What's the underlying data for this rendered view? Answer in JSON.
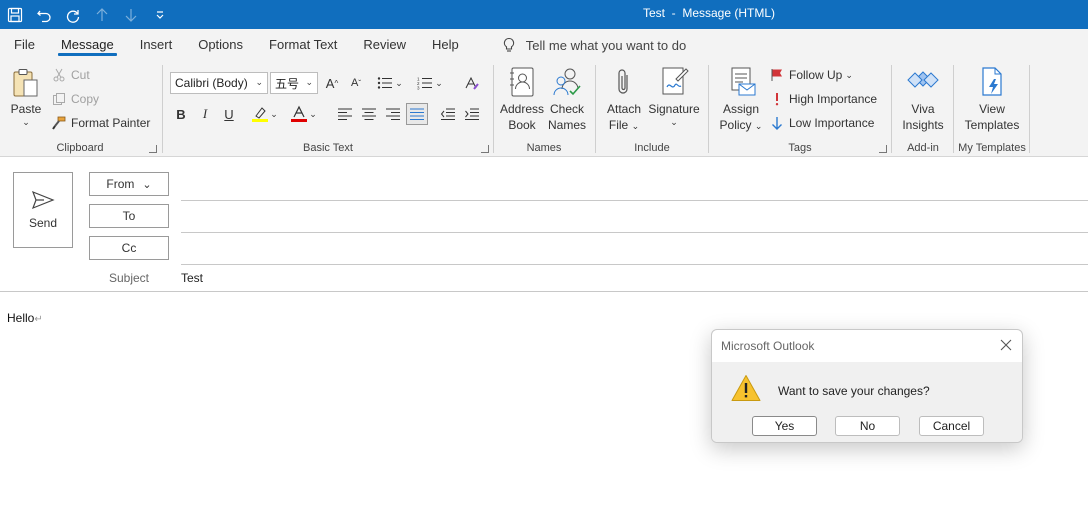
{
  "window": {
    "title": "Test  -  Message (HTML)"
  },
  "quick_access": [
    {
      "icon": "save-icon"
    },
    {
      "icon": "undo-icon"
    },
    {
      "icon": "redo-icon"
    },
    {
      "icon": "up-arrow-icon"
    },
    {
      "icon": "down-arrow-icon"
    },
    {
      "icon": "customize-icon"
    }
  ],
  "tabs": [
    {
      "label": "File"
    },
    {
      "label": "Message",
      "active": true
    },
    {
      "label": "Insert"
    },
    {
      "label": "Options"
    },
    {
      "label": "Format Text"
    },
    {
      "label": "Review"
    },
    {
      "label": "Help"
    }
  ],
  "tell_me": "Tell me what you want to do",
  "ribbon": {
    "clipboard": {
      "label": "Clipboard",
      "paste": "Paste",
      "cut": "Cut",
      "copy": "Copy",
      "format_painter": "Format Painter"
    },
    "basic_text": {
      "label": "Basic Text",
      "font_name": "Calibri (Body)",
      "font_size": "五号"
    },
    "names": {
      "label": "Names",
      "address_book_1": "Address",
      "address_book_2": "Book",
      "check_names_1": "Check",
      "check_names_2": "Names"
    },
    "include": {
      "label": "Include",
      "attach_1": "Attach",
      "attach_2": "File",
      "signature": "Signature"
    },
    "tags": {
      "label": "Tags",
      "assign_1": "Assign",
      "assign_2": "Policy",
      "follow_up": "Follow Up",
      "high": "High Importance",
      "low": "Low Importance"
    },
    "addin": {
      "label": "Add-in",
      "viva_1": "Viva",
      "viva_2": "Insights"
    },
    "templates": {
      "label": "My Templates",
      "view_1": "View",
      "view_2": "Templates"
    }
  },
  "compose": {
    "send": "Send",
    "from": "From",
    "to": "To",
    "cc": "Cc",
    "subject_label": "Subject",
    "subject": "Test",
    "body": "Hello"
  },
  "dialog": {
    "title": "Microsoft Outlook",
    "message": "Want to save your changes?",
    "yes": "Yes",
    "no": "No",
    "cancel": "Cancel"
  },
  "colors": {
    "accent": "#106ebe",
    "highlight": "#ffff00",
    "font_color": "#e00000",
    "flag": "#d13438",
    "importance": "#d13438",
    "low_importance": "#2b79d0"
  }
}
